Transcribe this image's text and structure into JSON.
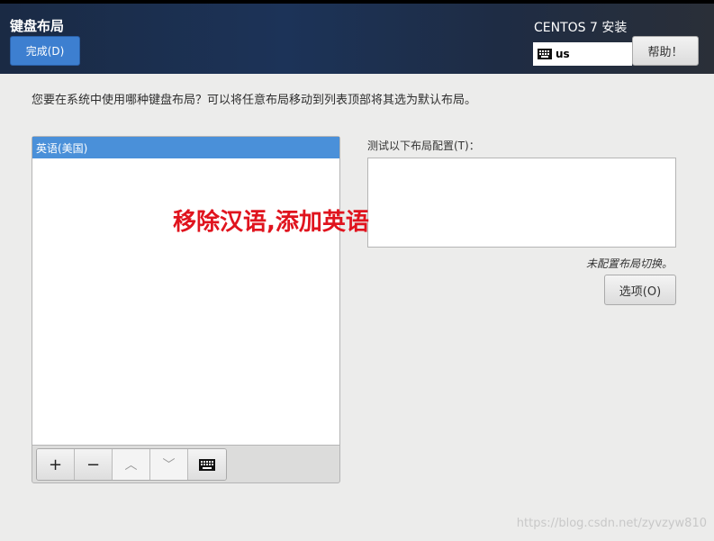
{
  "header": {
    "title": "键盘布局",
    "done_label": "完成(D)",
    "product": "CENTOS 7 安装",
    "keyboard_indicator": "us",
    "help_label": "帮助！"
  },
  "prompt": "您要在系统中使用哪种键盘布局？可以将任意布局移动到列表顶部将其选为默认布局。",
  "layouts": [
    "英语(美国)"
  ],
  "toolbar": {
    "add": "+",
    "remove": "−",
    "up": "︿",
    "down": "﹀"
  },
  "test": {
    "label": "测试以下布局配置(T)：",
    "value": ""
  },
  "switch_note": "未配置布局切换。",
  "options_label": "选项(O)",
  "annotation": "移除汉语,添加英语",
  "watermark": "https://blog.csdn.net/zyvzyw810"
}
